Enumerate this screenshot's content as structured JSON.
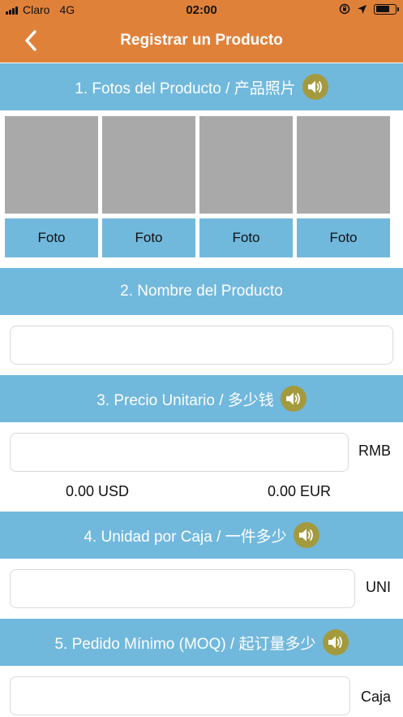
{
  "status_bar": {
    "carrier": "Claro",
    "network": "4G",
    "time": "02:00"
  },
  "nav": {
    "title": "Registrar un Producto"
  },
  "sections": {
    "photos": {
      "title": "1. Fotos del Producto / 产品照片"
    },
    "name": {
      "title": "2. Nombre del Producto"
    },
    "price": {
      "title": "3. Precio Unitario / 多少钱"
    },
    "unit": {
      "title": "4. Unidad por Caja / 一件多少"
    },
    "moq": {
      "title": "5. Pedido Mínimo (MOQ) / 起订量多少"
    }
  },
  "photos": [
    {
      "label": "Foto"
    },
    {
      "label": "Foto"
    },
    {
      "label": "Foto"
    },
    {
      "label": "Foto"
    }
  ],
  "fields": {
    "name": {
      "value": ""
    },
    "price": {
      "value": "",
      "unit": "RMB"
    },
    "unit": {
      "value": "",
      "unit": "UNI"
    },
    "moq": {
      "value": "",
      "unit": "Caja"
    }
  },
  "conversions": {
    "usd": "0.00 USD",
    "eur": "0.00 EUR"
  },
  "colors": {
    "nav": "#e0813a",
    "section": "#71b8dd",
    "speaker": "#a39a3e",
    "thumb": "#a9a9a9"
  },
  "icons": {
    "back": "chevron-left-icon",
    "speaker": "speaker-icon",
    "location": "location-arrow-icon",
    "lock": "rotation-lock-icon"
  }
}
